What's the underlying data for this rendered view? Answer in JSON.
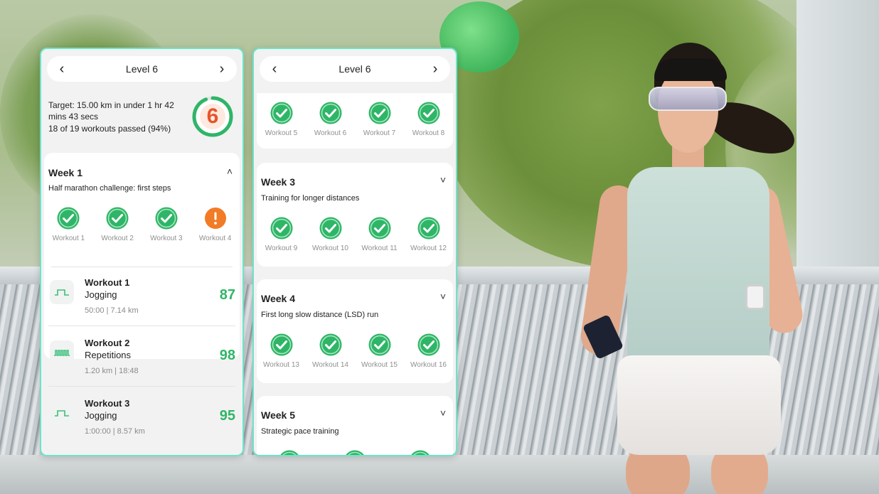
{
  "colors": {
    "accent_green": "#2fb568",
    "warn_orange": "#f27b26",
    "panel_border": "#6fe3c9"
  },
  "left_panel": {
    "header": {
      "title": "Level 6",
      "prev_icon": "chevron-left-icon",
      "next_icon": "chevron-right-icon"
    },
    "summary": {
      "target": "Target: 15.00 km in under 1 hr 42 mins 43 secs",
      "passed": "18 of 19 workouts passed (94%)",
      "level_badge": "6",
      "progress_fraction": 0.94
    },
    "week": {
      "title": "Week 1",
      "subtitle": "Half marathon challenge: first steps",
      "workouts": [
        {
          "label": "Workout 1",
          "status": "passed"
        },
        {
          "label": "Workout 2",
          "status": "passed"
        },
        {
          "label": "Workout 3",
          "status": "passed"
        },
        {
          "label": "Workout 4",
          "status": "warning"
        }
      ]
    },
    "workout_list": [
      {
        "name": "Workout 1",
        "kind": "Jogging",
        "meta": "50:00 | 7.14 km",
        "score": "87",
        "icon": "jogging-icon"
      },
      {
        "name": "Workout 2",
        "kind": "Repetitions",
        "meta": "1.20 km | 18:48",
        "score": "98",
        "icon": "repetitions-icon"
      },
      {
        "name": "Workout 3",
        "kind": "Jogging",
        "meta": "1:00:00 | 8.57 km",
        "score": "95",
        "icon": "jogging-icon"
      }
    ]
  },
  "right_panel": {
    "header": {
      "title": "Level 6",
      "prev_icon": "chevron-left-icon",
      "next_icon": "chevron-right-icon"
    },
    "week2_workouts": [
      {
        "label": "Workout 5",
        "status": "passed"
      },
      {
        "label": "Workout 6",
        "status": "passed"
      },
      {
        "label": "Workout 7",
        "status": "passed"
      },
      {
        "label": "Workout 8",
        "status": "passed"
      }
    ],
    "weeks": [
      {
        "title": "Week 3",
        "subtitle": "Training for longer distances",
        "workouts": [
          {
            "label": "Workout 9",
            "status": "passed"
          },
          {
            "label": "Workout 10",
            "status": "passed"
          },
          {
            "label": "Workout 11",
            "status": "passed"
          },
          {
            "label": "Workout 12",
            "status": "passed"
          }
        ]
      },
      {
        "title": "Week 4",
        "subtitle": "First long slow distance (LSD) run",
        "workouts": [
          {
            "label": "Workout 13",
            "status": "passed"
          },
          {
            "label": "Workout 14",
            "status": "passed"
          },
          {
            "label": "Workout 15",
            "status": "passed"
          },
          {
            "label": "Workout 16",
            "status": "passed"
          }
        ]
      },
      {
        "title": "Week 5",
        "subtitle": "Strategic pace training",
        "workouts": []
      }
    ]
  }
}
